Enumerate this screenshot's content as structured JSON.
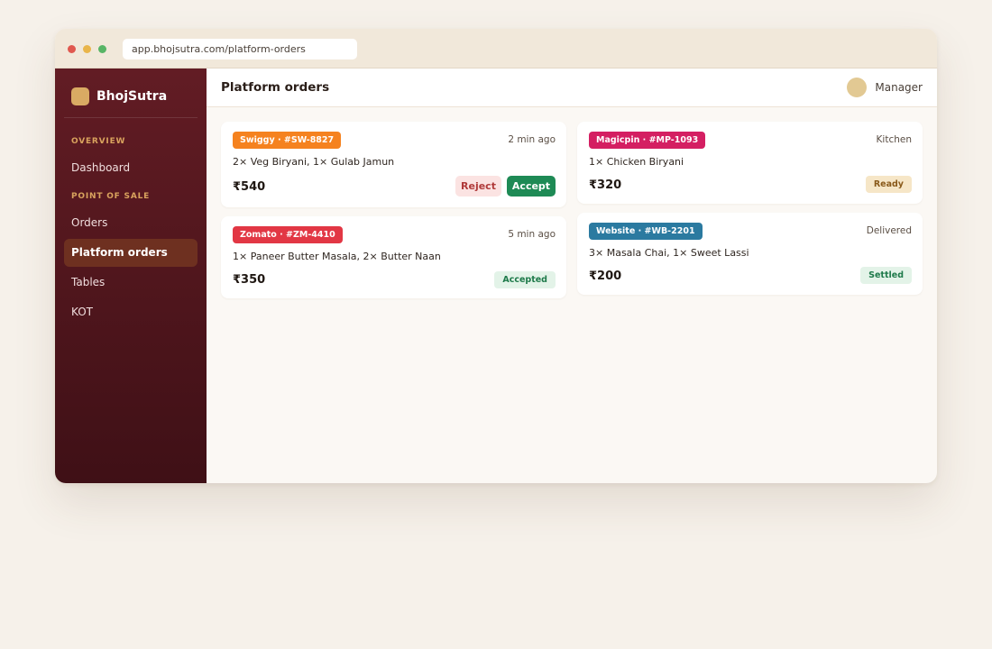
{
  "browser": {
    "url": "app.bhojsutra.com/platform-orders"
  },
  "sidebar": {
    "brand": "BhojSutra",
    "sections": [
      {
        "label": "OVERVIEW"
      },
      {
        "label": "POINT OF SALE"
      }
    ],
    "items": [
      {
        "label": "Dashboard",
        "active": false
      },
      {
        "label": "Orders",
        "active": false
      },
      {
        "label": "Platform orders",
        "active": true
      },
      {
        "label": "Tables",
        "active": false
      },
      {
        "label": "KOT",
        "active": false
      }
    ]
  },
  "header": {
    "title": "Platform orders",
    "user_role": "Manager"
  },
  "orders": [
    {
      "platform_tag": "Swiggy · #SW-8827",
      "time": "2 min ago",
      "items": "2× Veg Biryani, 1× Gulab Jamun",
      "price": "₹540",
      "reject_label": "Reject",
      "accept_label": "Accept"
    },
    {
      "platform_tag": "Zomato · #ZM-4410",
      "time": "5 min ago",
      "items": "1× Paneer Butter Masala, 2× Butter Naan",
      "price": "₹350",
      "status": "Accepted"
    },
    {
      "platform_tag": "Magicpin · #MP-1093",
      "stage": "Kitchen",
      "items": "1× Chicken Biryani",
      "price": "₹320",
      "status": "Ready"
    },
    {
      "platform_tag": "Website · #WB-2201",
      "stage": "Delivered",
      "items": "3× Masala Chai, 1× Sweet Lassi",
      "price": "₹200",
      "status": "Settled"
    }
  ],
  "colors": {
    "swiggy": "#f5821f",
    "zomato": "#e23744",
    "magicpin": "#d41f62",
    "website": "#2b7aa0",
    "accept": "#1e8a55",
    "sidebar_top": "#621c24",
    "sidebar_active": "#6e3020"
  }
}
